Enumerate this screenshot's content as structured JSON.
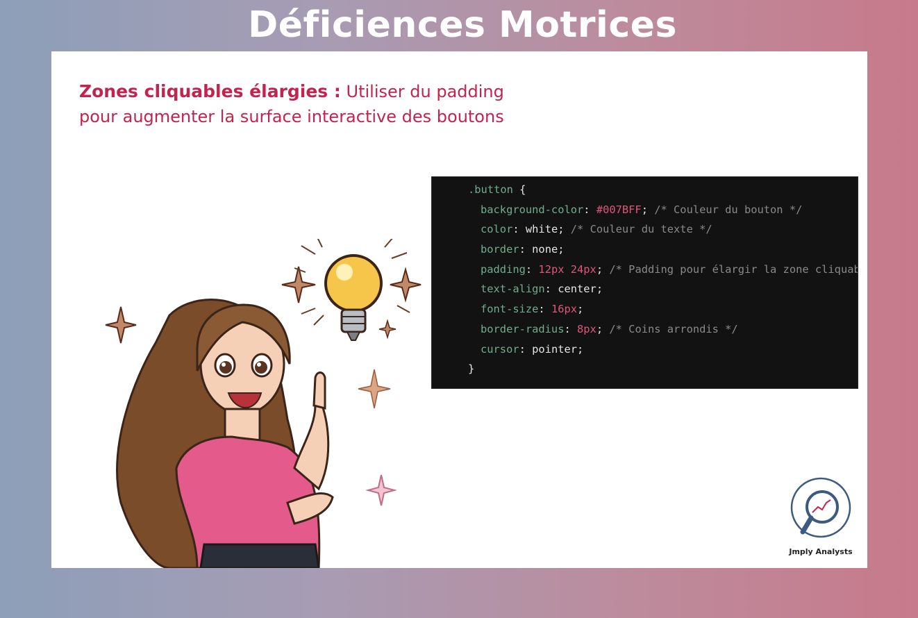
{
  "slide": {
    "title": "Déficiences Motrices"
  },
  "heading": {
    "bold": "Zones cliquables élargies :",
    "line1_rest": " Utiliser du padding",
    "line2": "pour augmenter la surface interactive des boutons"
  },
  "code": {
    "selector": ".button",
    "open_brace": " {",
    "close_brace": "}",
    "lines": [
      {
        "prop": "background-color",
        "value": "#007BFF",
        "comment": " /* Couleur du bouton */"
      },
      {
        "prop": "color",
        "value": "white",
        "comment": " /* Couleur du texte */"
      },
      {
        "prop": "border",
        "value": "none",
        "comment": ""
      },
      {
        "prop": "padding",
        "value": "12px 24px",
        "comment": " /* Padding pour élargir la zone cliquabl"
      },
      {
        "prop": "text-align",
        "value": "center",
        "comment": ""
      },
      {
        "prop": "font-size",
        "value": "16px",
        "comment": ""
      },
      {
        "prop": "border-radius",
        "value": "8px",
        "comment": " /* Coins arrondis */"
      },
      {
        "prop": "cursor",
        "value": "pointer",
        "comment": ""
      }
    ]
  },
  "logo": {
    "label": "Jmply Analysts",
    "icon": "magnifier-chart-icon"
  },
  "illustration": {
    "icon": "woman-lightbulb-idea-illustration"
  },
  "colors": {
    "accent": "#c3244f",
    "code_bg": "#121212",
    "code_prop": "#6fae8e",
    "code_number": "#e0567a",
    "code_comment": "#8a8a8a"
  }
}
